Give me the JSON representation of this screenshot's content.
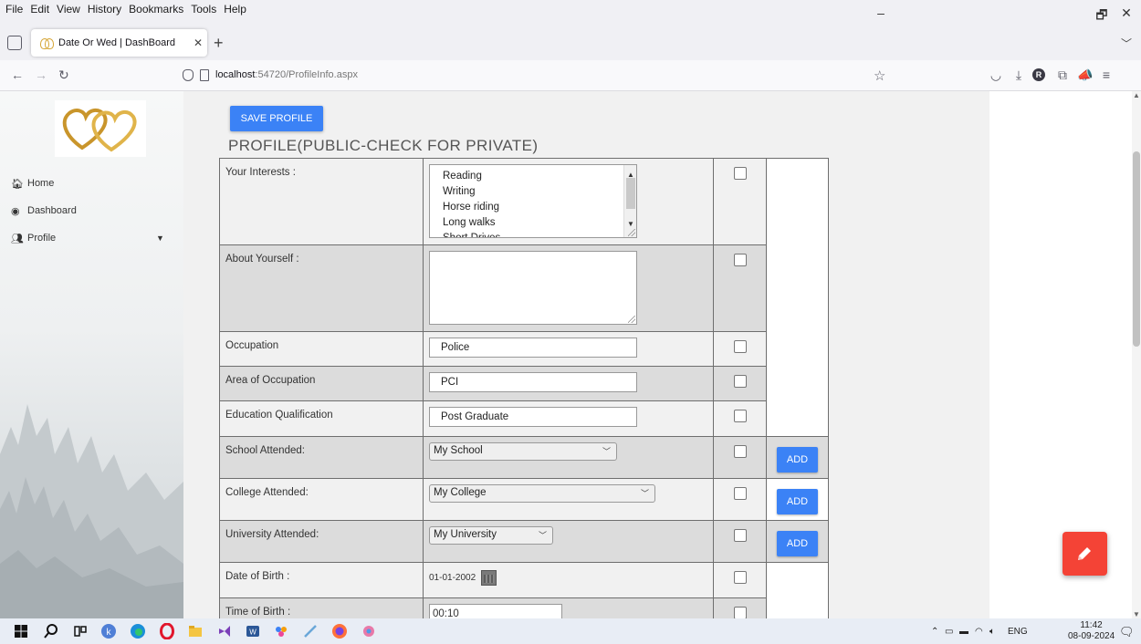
{
  "browser": {
    "menus": [
      "File",
      "Edit",
      "View",
      "History",
      "Bookmarks",
      "Tools",
      "Help"
    ],
    "tab_title": "Date Or Wed | DashBoard",
    "url_host": "localhost",
    "url_rest": ":54720/ProfileInfo.aspx"
  },
  "sidebar": {
    "items": [
      {
        "label": "Home",
        "icon": "home-icon"
      },
      {
        "label": "Dashboard",
        "icon": "dashboard-icon"
      },
      {
        "label": "Profile",
        "icon": "users-icon"
      }
    ]
  },
  "main": {
    "save_label": "SAVE PROFILE",
    "title": "PROFILE(PUBLIC-CHECK FOR PRIVATE)",
    "interests_label": "Your Interests :",
    "interests_options": [
      "Reading",
      "Writing",
      "Horse riding",
      "Long walks",
      "Short Drives"
    ],
    "about_label": "About Yourself :",
    "occupation_label": "Occupation",
    "occupation_value": "Police",
    "area_label": "Area of Occupation",
    "area_value": "PCI",
    "education_label": "Education Qualification",
    "education_value": "Post Graduate",
    "school_label": "School Attended:",
    "school_value": "My School",
    "college_label": "College Attended:",
    "college_value": "My College",
    "university_label": "University Attended:",
    "university_value": "My University",
    "add_label": "ADD",
    "dob_label": "Date of Birth :",
    "dob_value": "01-01-2002",
    "tob_label": "Time of Birth :",
    "tob_value": "00:10"
  },
  "taskbar": {
    "lang": "ENG",
    "time": "11:42",
    "date": "08-09-2024"
  },
  "colors": {
    "accent": "#3b82f6",
    "fab": "#f44336",
    "alt_row": "#dcdcdc"
  }
}
